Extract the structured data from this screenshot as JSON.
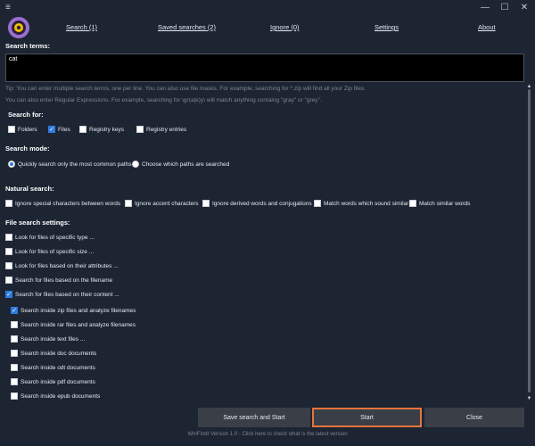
{
  "titlebar": {
    "menu_icon": "hamburger-menu-icon",
    "controls": [
      "—",
      "☐",
      "✕"
    ]
  },
  "nav": {
    "search": "Search (1)",
    "saved": "Saved searches (2)",
    "ignore": "Ignore (0)",
    "settings": "Settings",
    "about": "About"
  },
  "search_terms": {
    "label": "Search terms:",
    "value": "cat",
    "tip1": "Tip: You can enter multiple search terms, one per line. You can also use file masks. For example, searching for *.zip will find all your Zip files.",
    "tip2": "You can also enter Regular Expressions. For example, searching for \\gr(a|e)y\\ will match anything containg \"gray\" or \"grey\"."
  },
  "search_for": {
    "label": "Search for:",
    "options": [
      {
        "label": "Folders",
        "checked": false
      },
      {
        "label": "Files",
        "checked": true
      },
      {
        "label": "Registry keys",
        "checked": false
      },
      {
        "label": "Registry entries",
        "checked": false
      }
    ]
  },
  "search_mode": {
    "label": "Search mode:",
    "options": [
      {
        "label": "Quickly search only the most common paths",
        "checked": true
      },
      {
        "label": "Choose which paths are searched",
        "checked": false
      }
    ]
  },
  "natural_search": {
    "label": "Natural search:",
    "options": [
      {
        "label": "Ignore special characters between words",
        "checked": false
      },
      {
        "label": "Ignore accent characters",
        "checked": false
      },
      {
        "label": "Ignore derived words and conjugations",
        "checked": false
      },
      {
        "label": "Match words which sound similar",
        "checked": false
      },
      {
        "label": "Match similar words",
        "checked": false
      }
    ]
  },
  "file_settings": {
    "label": "File search settings:",
    "options": [
      {
        "label": "Look for files of specific type ...",
        "checked": false
      },
      {
        "label": "Look for files of specific size ...",
        "checked": false
      },
      {
        "label": "Look for files based on their attributes ...",
        "checked": false
      },
      {
        "label": "Search for files based on the filename",
        "checked": false
      },
      {
        "label": "Search for files based on their content ...",
        "checked": true
      }
    ],
    "content_options": [
      {
        "label": "Search inside zip files and analyze filenames",
        "checked": true
      },
      {
        "label": "Search inside rar files and analyze filenames",
        "checked": false
      },
      {
        "label": "Search inside text files ...",
        "checked": false
      },
      {
        "label": "Search inside doc documents",
        "checked": false
      },
      {
        "label": "Search inside odt documents",
        "checked": false
      },
      {
        "label": "Search inside pdf documents",
        "checked": false
      },
      {
        "label": "Search inside epub documents",
        "checked": false
      }
    ]
  },
  "buttons": {
    "save_start": "Save search and Start",
    "start": "Start",
    "close": "Close"
  },
  "footer": "WinFindr Version 1.0 - Click here to check what is the latest version",
  "colors": {
    "background": "#1d2533",
    "accent": "#2f7be0",
    "highlight_border": "#e8743b",
    "logo_ring": "#9b6fd0",
    "logo_fill": "#f2c300"
  }
}
